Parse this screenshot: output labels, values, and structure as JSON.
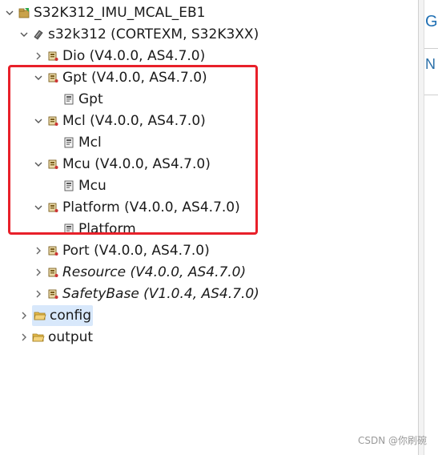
{
  "tree": {
    "root": {
      "label": "S32K312_IMU_MCAL_EB1",
      "expanded": true,
      "children_header": {
        "label": "s32k312 (CORTEXM, S32K3XX)",
        "expanded": true
      }
    },
    "modules": [
      {
        "label": "Dio (V4.0.0, AS4.7.0)",
        "expanded": false,
        "italic": false
      },
      {
        "label": "Gpt (V4.0.0, AS4.7.0)",
        "expanded": true,
        "italic": false,
        "child": "Gpt"
      },
      {
        "label": "Mcl (V4.0.0, AS4.7.0)",
        "expanded": true,
        "italic": false,
        "child": "Mcl"
      },
      {
        "label": "Mcu (V4.0.0, AS4.7.0)",
        "expanded": true,
        "italic": false,
        "child": "Mcu"
      },
      {
        "label": "Platform (V4.0.0, AS4.7.0)",
        "expanded": true,
        "italic": false,
        "child": "Platform"
      },
      {
        "label": "Port (V4.0.0, AS4.7.0)",
        "expanded": false,
        "italic": false
      },
      {
        "label": "Resource (V4.0.0, AS4.7.0)",
        "expanded": false,
        "italic": true
      },
      {
        "label": "SafetyBase (V1.0.4, AS4.7.0)",
        "expanded": false,
        "italic": true
      }
    ],
    "folders": [
      {
        "label": "config",
        "selected": true
      },
      {
        "label": "output",
        "selected": false
      }
    ]
  },
  "right_panel": {
    "letter_top": "G",
    "letter_second": "N"
  },
  "watermark": "CSDN @你刷碗",
  "colors": {
    "highlight": "#e8202a",
    "selection": "#d8e8fb",
    "accent": "#1f6fb3"
  }
}
